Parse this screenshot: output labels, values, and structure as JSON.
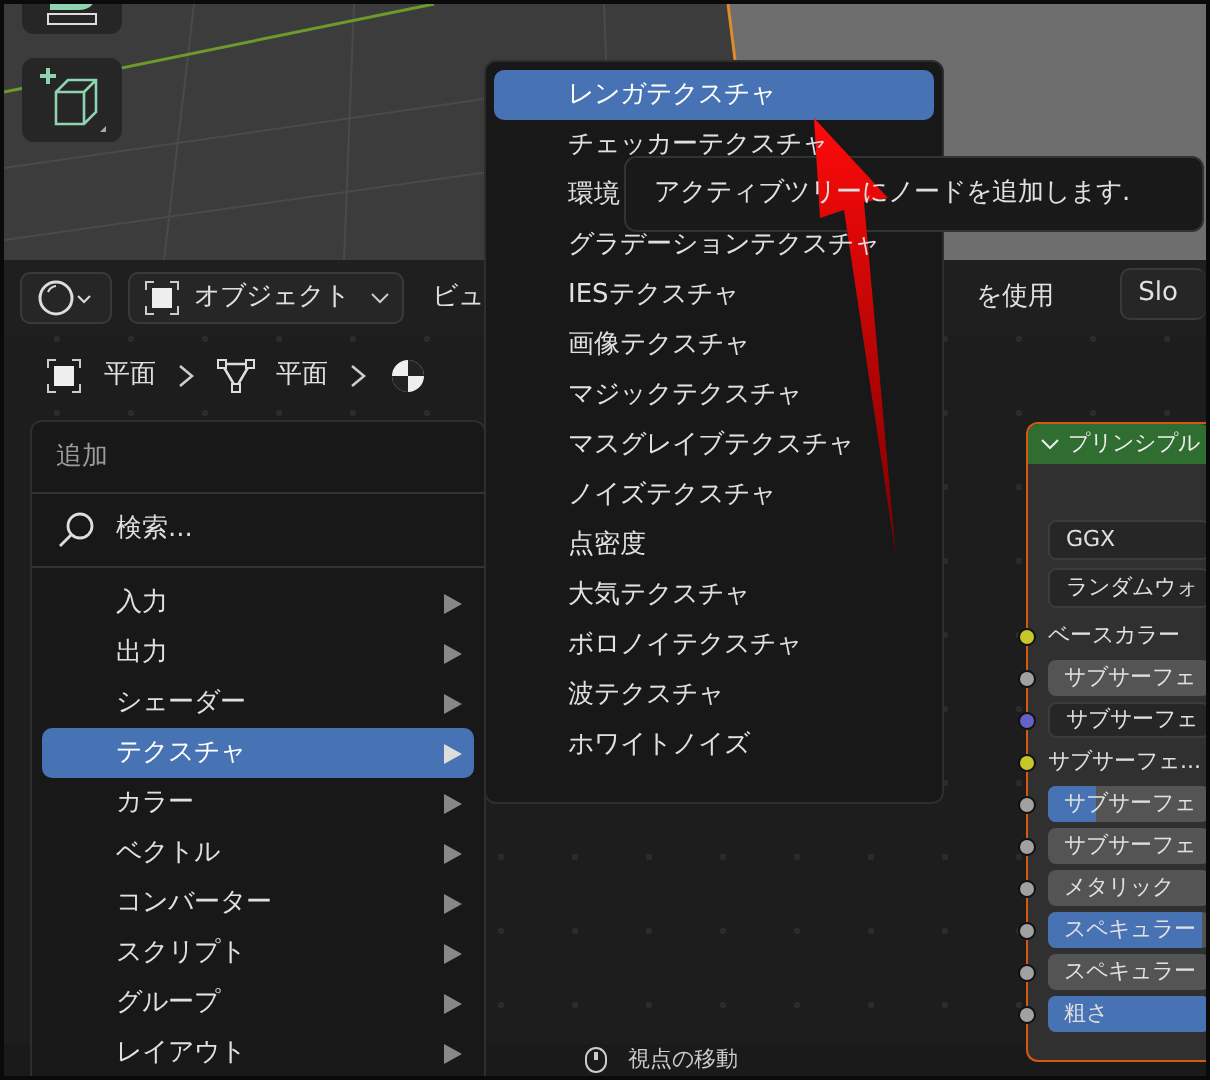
{
  "viewport": {
    "tools": [
      {
        "kind": "measure"
      },
      {
        "kind": "add-cube"
      }
    ]
  },
  "header": {
    "mode_dropdown": {
      "label": "オブジェクト"
    },
    "menus": [
      "ビュ",
      "を使用"
    ],
    "slot_button": {
      "label": "Slo"
    }
  },
  "breadcrumb": [
    {
      "kind": "object",
      "label": "平面"
    },
    {
      "kind": "mesh",
      "label": "平面"
    },
    {
      "kind": "material"
    }
  ],
  "add_menu": {
    "title": "追加",
    "search": {
      "placeholder": "検索..."
    },
    "items": [
      {
        "label": "入力",
        "selected": false
      },
      {
        "label": "出力",
        "selected": false
      },
      {
        "label": "シェーダー",
        "selected": false
      },
      {
        "label": "テクスチャ",
        "selected": true
      },
      {
        "label": "カラー",
        "selected": false
      },
      {
        "label": "ベクトル",
        "selected": false
      },
      {
        "label": "コンバーター",
        "selected": false
      },
      {
        "label": "スクリプト",
        "selected": false
      },
      {
        "label": "グループ",
        "selected": false
      },
      {
        "label": "レイアウト",
        "selected": false
      }
    ]
  },
  "texture_submenu": {
    "items": [
      {
        "label": "レンガテクスチャ",
        "selected": true
      },
      {
        "label": "チェッカーテクスチャ",
        "selected": false
      },
      {
        "label": "環境",
        "selected": false
      },
      {
        "label": "グラデーションテクスチャ",
        "selected": false
      },
      {
        "label": "IESテクスチャ",
        "selected": false
      },
      {
        "label": "画像テクスチャ",
        "selected": false
      },
      {
        "label": "マジックテクスチャ",
        "selected": false
      },
      {
        "label": "マスグレイブテクスチャ",
        "selected": false
      },
      {
        "label": "ノイズテクスチャ",
        "selected": false
      },
      {
        "label": "点密度",
        "selected": false
      },
      {
        "label": "大気テクスチャ",
        "selected": false
      },
      {
        "label": "ボロノイテクスチャ",
        "selected": false
      },
      {
        "label": "波テクスチャ",
        "selected": false
      },
      {
        "label": "ホワイトノイズ",
        "selected": false
      }
    ]
  },
  "tooltip": {
    "text": "アクティブツリーにノードを追加します."
  },
  "node": {
    "title": "プリンシプル",
    "expanded": true,
    "dropdowns": [
      "GGX",
      "ランダムウォ"
    ],
    "sockets": [
      {
        "kind": "label",
        "label": "ベースカラー",
        "color": "#c7c729"
      },
      {
        "kind": "field",
        "label": "サブサーフェ",
        "color": "#a1a1a1"
      },
      {
        "kind": "vector",
        "label": "サブサーフェ",
        "color": "#6363c7"
      },
      {
        "kind": "label",
        "label": "サブサーフェ...",
        "color": "#c7c729"
      },
      {
        "kind": "slider",
        "label": "サブサーフェ",
        "color": "#a1a1a1",
        "level": 0.3
      },
      {
        "kind": "field",
        "label": "サブサーフェ",
        "color": "#a1a1a1"
      },
      {
        "kind": "field",
        "label": "メタリック",
        "color": "#a1a1a1"
      },
      {
        "kind": "slider",
        "label": "スペキュラー",
        "color": "#a1a1a1",
        "level": 0.95
      },
      {
        "kind": "field",
        "label": "スペキュラー",
        "color": "#a1a1a1"
      },
      {
        "kind": "slider",
        "label": "粗さ",
        "color": "#a1a1a1",
        "level": 1
      }
    ]
  },
  "status_bar": {
    "hint": "視点の移動"
  }
}
